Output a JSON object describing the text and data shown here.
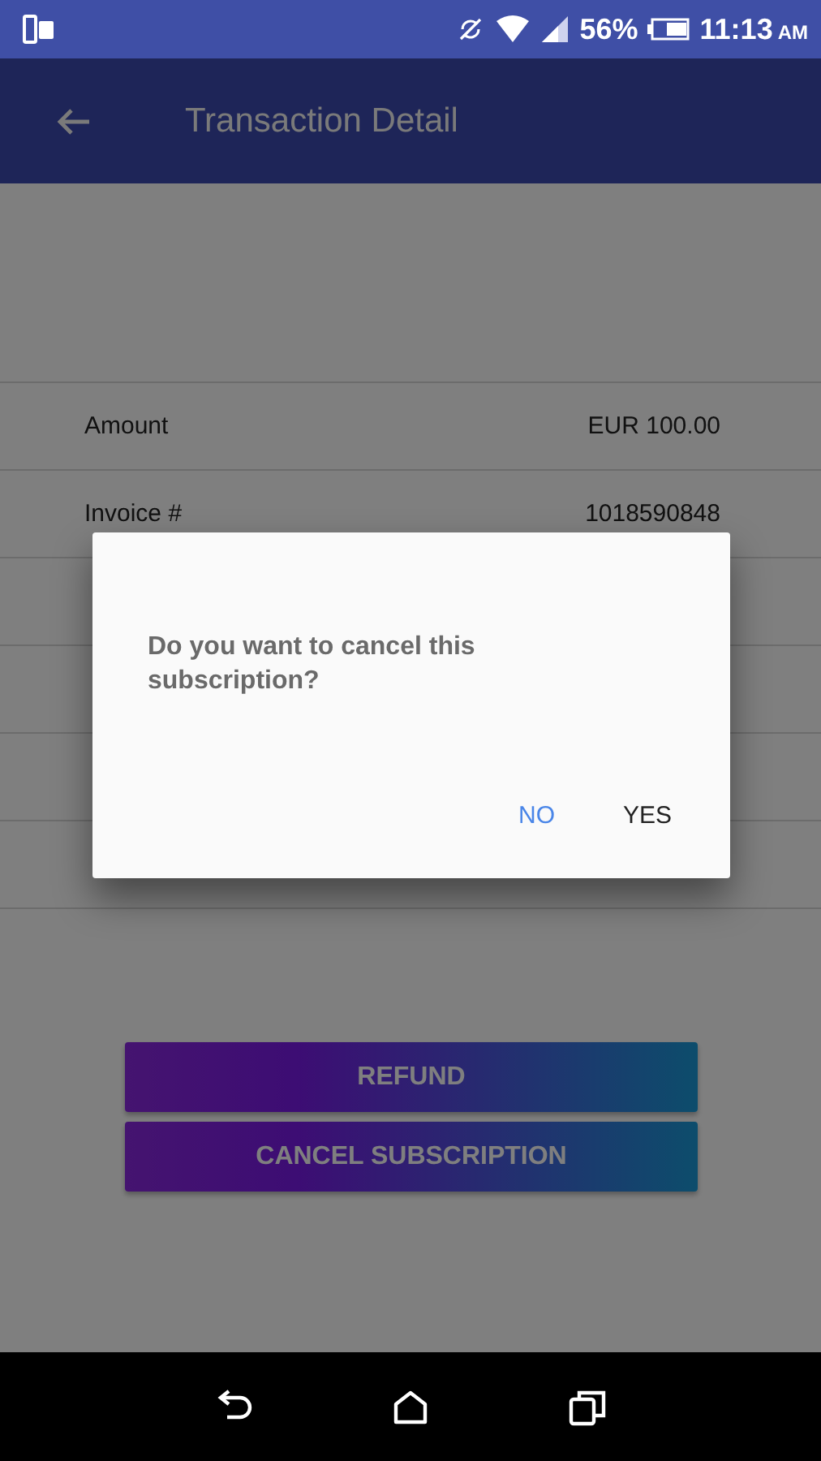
{
  "status_bar": {
    "battery": "56%",
    "time": "11:13",
    "period": "AM"
  },
  "app_bar": {
    "title": "Transaction Detail"
  },
  "details": [
    {
      "label": "Amount",
      "value": "EUR 100.00"
    },
    {
      "label": "Invoice #",
      "value": "1018590848"
    }
  ],
  "actions": [
    "REFUND",
    "CANCEL SUBSCRIPTION"
  ],
  "dialog": {
    "message": "Do you want to cancel this subscription?",
    "buttons": [
      {
        "label": "NO",
        "kind": "primary"
      },
      {
        "label": "YES",
        "kind": "default"
      }
    ]
  }
}
